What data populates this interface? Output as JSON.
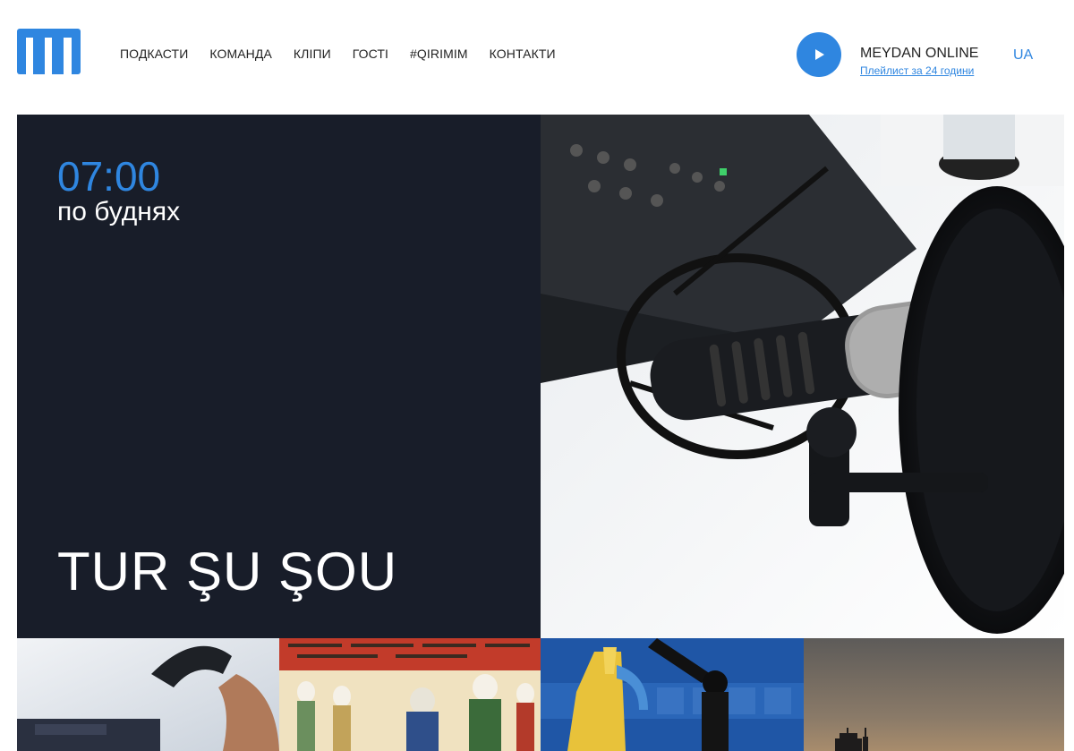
{
  "header": {
    "logo_icon": "meydan-logo-icon",
    "nav": [
      {
        "label": "ПОДКАСТИ"
      },
      {
        "label": "КОМАНДА"
      },
      {
        "label": "КЛІПИ"
      },
      {
        "label": "ГОСТІ"
      },
      {
        "label": "#QIRIMIM"
      },
      {
        "label": "КОНТАКТИ"
      }
    ],
    "player": {
      "play_icon": "play-icon",
      "title": "MEYDAN ONLINE",
      "playlist_link": "Плейлист за 24 години"
    },
    "language": "UA"
  },
  "hero": {
    "time": "07:00",
    "days": "по буднях",
    "show_title": "TUR ŞU ŞOU",
    "image": "studio-microphone-photo"
  },
  "tiles": [
    {
      "image": "telephone-handset-photo"
    },
    {
      "image": "ottoman-miniature-painting"
    },
    {
      "image": "microphone-with-ribbon-photo"
    },
    {
      "image": "city-skyline-dusk-photo"
    }
  ],
  "colors": {
    "accent": "#2f86e0",
    "hero_bg": "#181d29",
    "text": "#222222"
  }
}
